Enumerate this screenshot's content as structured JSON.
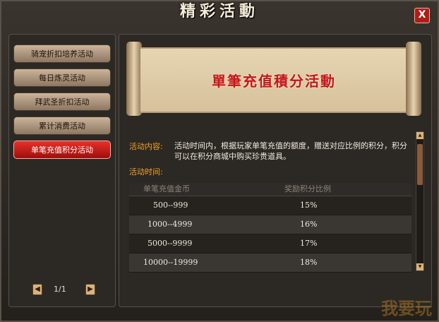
{
  "window": {
    "title": "精彩活動",
    "close": "X"
  },
  "sidebar": {
    "items": [
      {
        "label": "骑宠折扣培养活动"
      },
      {
        "label": "每日炼灵活动"
      },
      {
        "label": "拜武圣折扣活动"
      },
      {
        "label": "累计消费活动"
      },
      {
        "label": "单笔充值积分活动"
      }
    ],
    "pager": {
      "text": "1/1",
      "prev": "◀",
      "next": "▶"
    }
  },
  "main": {
    "banner_title": "單筆充值積分活動",
    "content_label": "活动内容:",
    "content_text": "活动时间内，根据玩家单笔充值的额度，赠送对应比例的积分，积分可以在积分商城中购买珍贵道具。",
    "time_label": "活动时间:",
    "table": {
      "headers": [
        "单笔充值金币",
        "奖励积分比例"
      ],
      "rows": [
        [
          "500--999",
          "15%"
        ],
        [
          "1000--4999",
          "16%"
        ],
        [
          "5000--9999",
          "17%"
        ],
        [
          "10000--19999",
          "18%"
        ]
      ]
    }
  },
  "watermark": "我要玩"
}
